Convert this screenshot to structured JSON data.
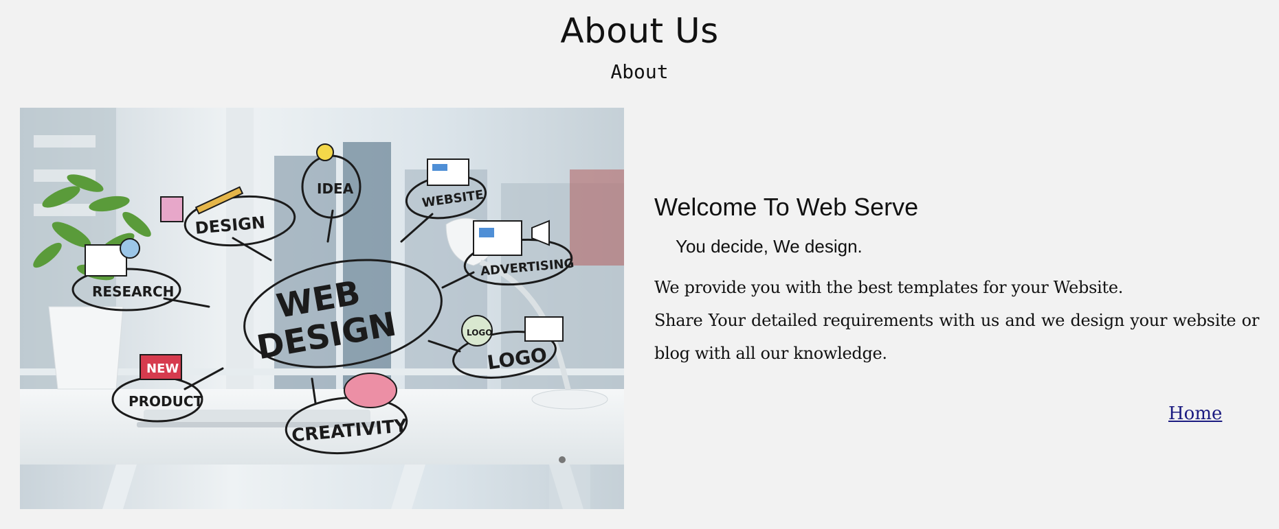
{
  "header": {
    "title": "About Us",
    "subtitle": "About"
  },
  "hero_image": {
    "alt": "Web design concept doodles over a bright office desk",
    "labels": {
      "web_design_1": "WEB",
      "web_design_2": "DESIGN",
      "design": "DESIGN",
      "idea": "IDEA",
      "website": "WEBSITE",
      "research": "RESEARCH",
      "advertising": "ADVERTISING",
      "logo": "LOGO",
      "logo_badge": "LOGO",
      "new": "NEW",
      "product": "PRODUCT",
      "creativity": "CREATIVITY"
    }
  },
  "main": {
    "welcome_title": "Welcome To Web Serve",
    "tagline": "You decide, We design.",
    "paragraph_1": "We provide you with the best templates for your Website.",
    "paragraph_2": "Share Your detailed requirements with us and we design your website or blog with all our knowledge."
  },
  "nav": {
    "home_label": "Home"
  },
  "colors": {
    "background": "#f2f2f2",
    "link": "#1a1a80"
  }
}
